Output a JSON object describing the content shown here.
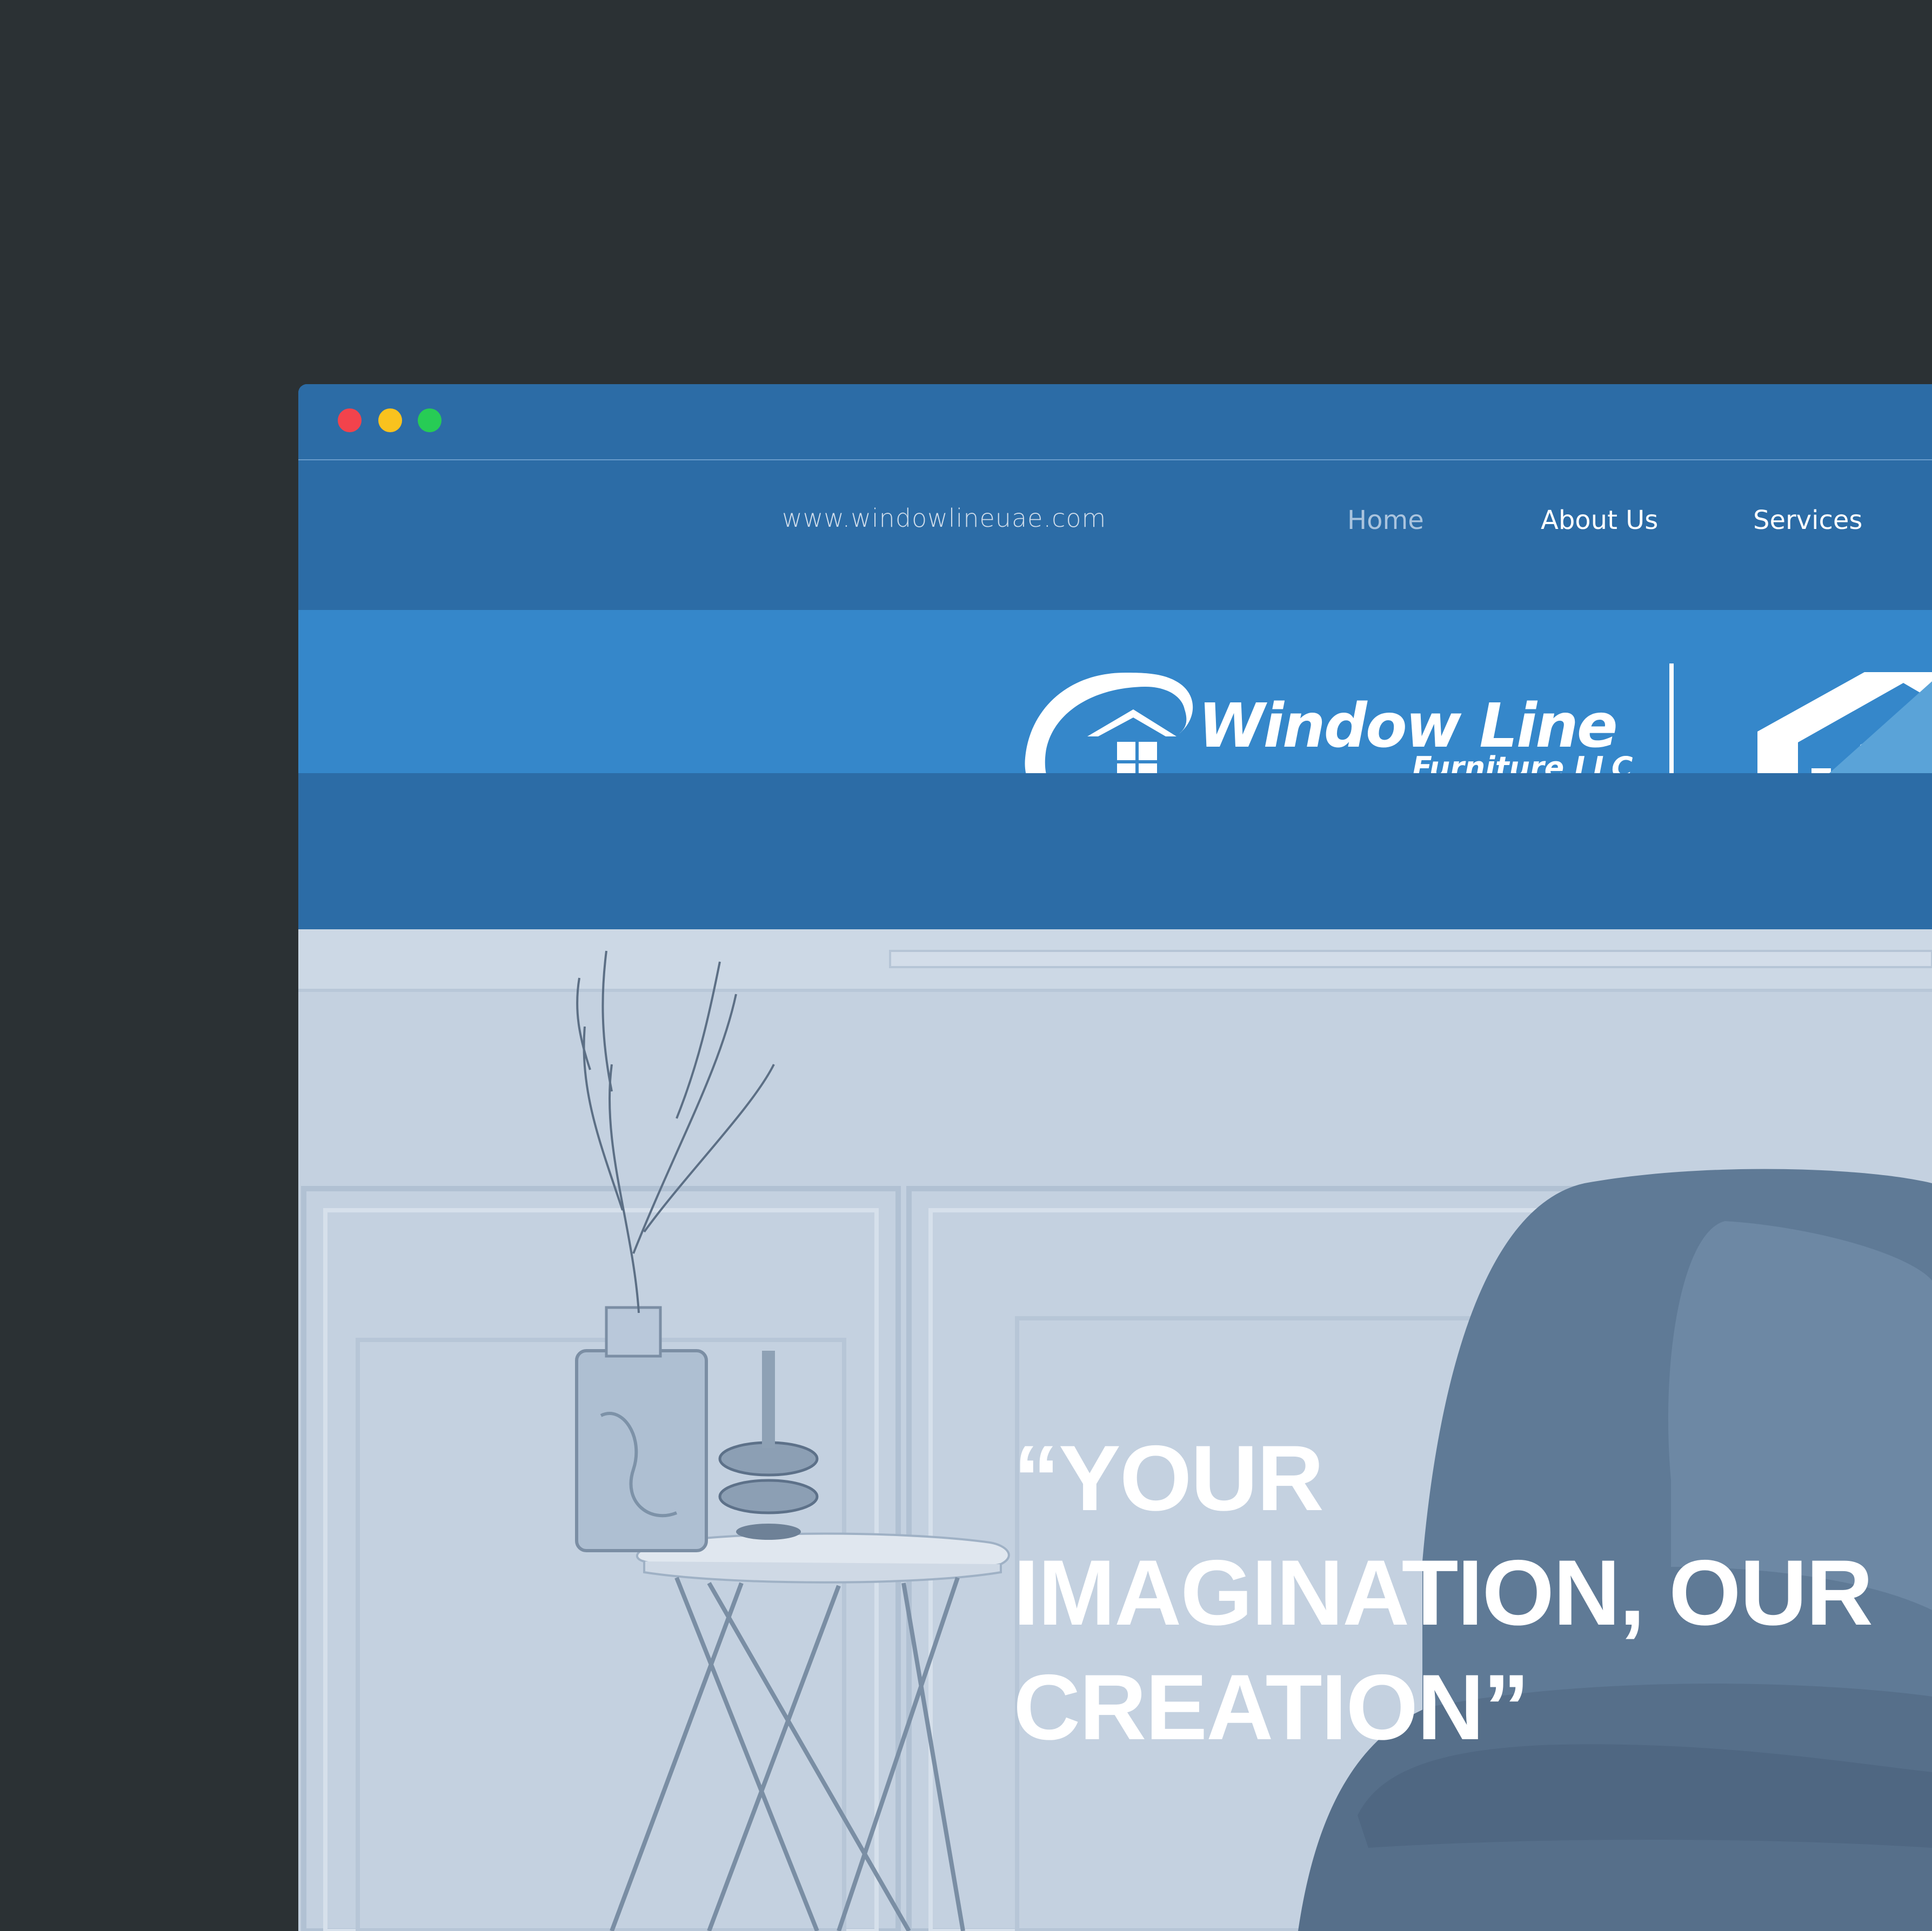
{
  "window": {
    "controls": [
      "close",
      "minimize",
      "maximize"
    ]
  },
  "nav": {
    "url": "www.windowlineuae.com",
    "items": [
      {
        "label": "Home",
        "active": true
      },
      {
        "label": "About Us"
      },
      {
        "label": "Services"
      }
    ]
  },
  "brand": {
    "logo_title": "Window Line",
    "logo_subtitle": "Furniture LLC",
    "colors": {
      "nav_bg": "#2c6ca6",
      "brand_bg": "#3587ca",
      "page_bg": "#2b3134"
    }
  },
  "hero": {
    "headline_lines": [
      "“YOUR",
      "IMAGINATION, OUR",
      "CREATION”"
    ]
  }
}
